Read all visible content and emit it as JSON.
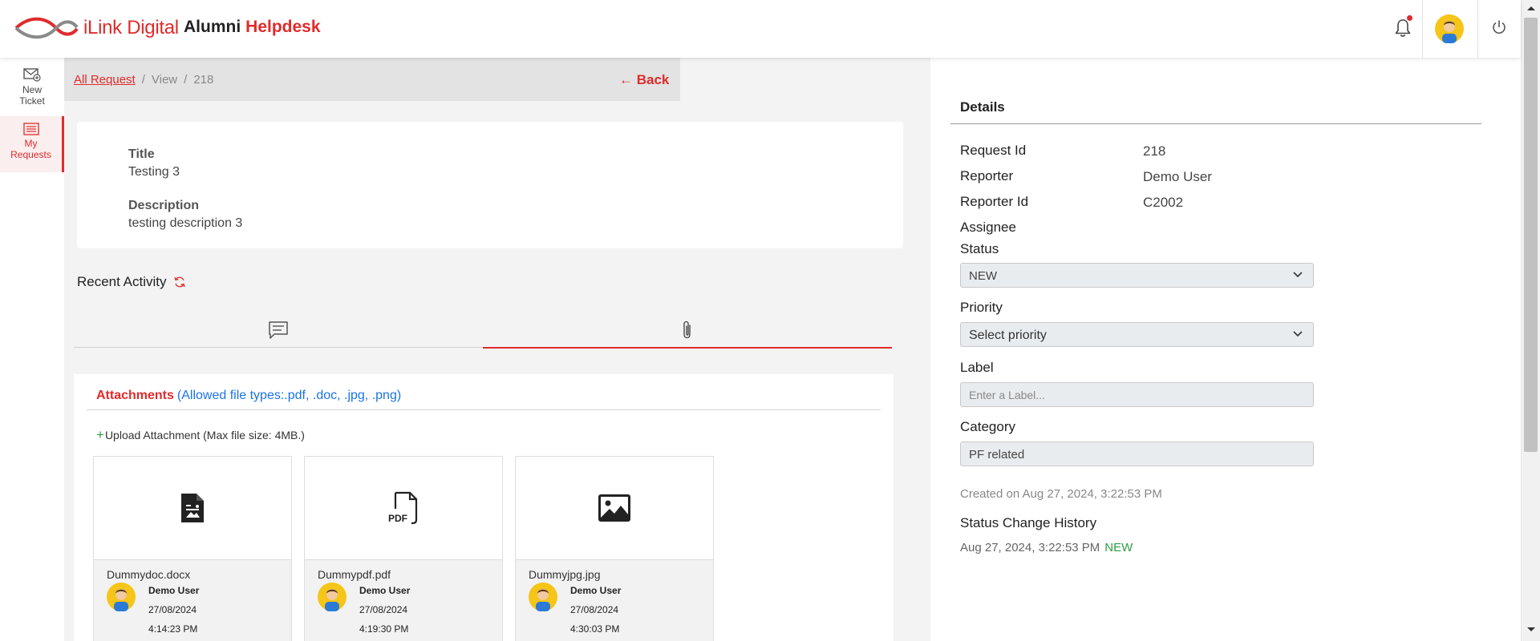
{
  "header": {
    "brand": "iLink Digital",
    "app_name_1": "Alumni",
    "app_name_2": "Helpdesk",
    "accent_color": "#e02b2b"
  },
  "nav": {
    "new_ticket": [
      "New",
      "Ticket"
    ],
    "my_requests": [
      "My",
      "Requests"
    ]
  },
  "breadcrumb": {
    "root": "All Request",
    "view": "View",
    "id": "218",
    "back": "Back"
  },
  "request": {
    "title_label": "Title",
    "title": "Testing 3",
    "description_label": "Description",
    "description": "testing description 3"
  },
  "activity": {
    "heading": "Recent Activity"
  },
  "attachments": {
    "heading": "Attachments",
    "allowed": "(Allowed file types:.pdf, .doc, .jpg, .png)",
    "upload": "Upload Attachment (Max file size: 4MB.)",
    "files": [
      {
        "name": "Dummydoc.docx",
        "user": "Demo User",
        "date": "27/08/2024",
        "time": "4:14:23 PM",
        "icon": "document-icon"
      },
      {
        "name": "Dummypdf.pdf",
        "user": "Demo User",
        "date": "27/08/2024",
        "time": "4:19:30 PM",
        "icon": "pdf-icon"
      },
      {
        "name": "Dummyjpg.jpg",
        "user": "Demo User",
        "date": "27/08/2024",
        "time": "4:30:03 PM",
        "icon": "image-icon"
      }
    ]
  },
  "details": {
    "heading": "Details",
    "request_id_label": "Request Id",
    "request_id": "218",
    "reporter_label": "Reporter",
    "reporter": "Demo User",
    "reporter_id_label": "Reporter Id",
    "reporter_id": "C2002",
    "assignee_label": "Assignee",
    "status_label": "Status",
    "status": "NEW",
    "priority_label": "Priority",
    "priority_placeholder": "Select priority",
    "label_label": "Label",
    "label_placeholder": "Enter a Label...",
    "category_label": "Category",
    "category": "PF related",
    "created": "Created on Aug 27, 2024, 3:22:53 PM",
    "history_heading": "Status Change History",
    "history_time": "Aug 27, 2024, 3:22:53 PM",
    "history_status": "NEW"
  }
}
